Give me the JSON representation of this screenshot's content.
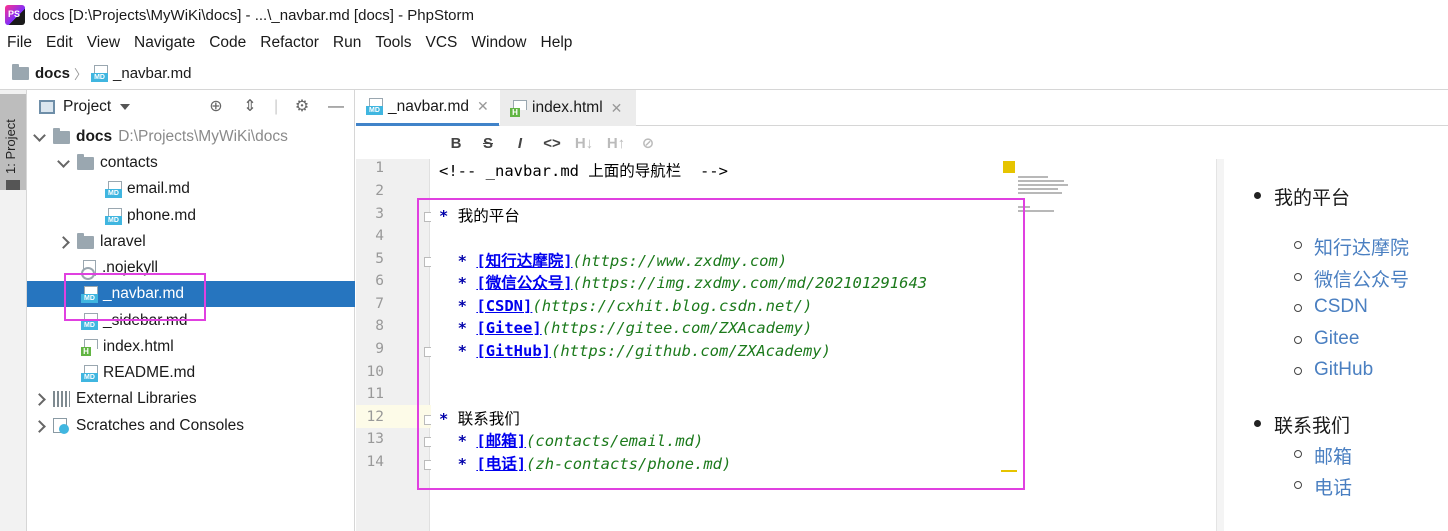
{
  "window": {
    "title": "docs [D:\\Projects\\MyWiKi\\docs] - ...\\_navbar.md [docs] - PhpStorm"
  },
  "menu": [
    "File",
    "Edit",
    "View",
    "Navigate",
    "Code",
    "Refactor",
    "Run",
    "Tools",
    "VCS",
    "Window",
    "Help"
  ],
  "breadcrumb": {
    "root": "docs",
    "file": "_navbar.md"
  },
  "side_strip": {
    "label": "1: Project"
  },
  "project_panel": {
    "title": "Project",
    "tree": [
      {
        "label": "docs",
        "path": "D:\\Projects\\MyWiKi\\docs"
      },
      {
        "label": "contacts"
      },
      {
        "label": "email.md"
      },
      {
        "label": "phone.md"
      },
      {
        "label": "laravel"
      },
      {
        "label": ".nojekyll"
      },
      {
        "label": "_navbar.md"
      },
      {
        "label": "_sidebar.md"
      },
      {
        "label": "index.html"
      },
      {
        "label": "README.md"
      },
      {
        "label": "External Libraries"
      },
      {
        "label": "Scratches and Consoles"
      }
    ]
  },
  "editor_tabs": [
    {
      "label": "_navbar.md",
      "active": true
    },
    {
      "label": "index.html",
      "active": false
    }
  ],
  "md_toolbar": [
    "B",
    "S",
    "I",
    "<>",
    "H↓",
    "H↑",
    "link"
  ],
  "code_lines": {
    "l1": "<!-- _navbar.md 上面的导航栏  -->",
    "l3": "我的平台",
    "l5_link": "[知行达摩院]",
    "l5_url": "(https://www.zxdmy.com)",
    "l6_link": "[微信公众号]",
    "l6_url": "(https://img.zxdmy.com/md/202101291643",
    "l7_link": "[CSDN]",
    "l7_url": "(https://cxhit.blog.csdn.net/)",
    "l8_link": "[Gitee]",
    "l8_url": "(https://gitee.com/ZXAcademy)",
    "l9_link": "[GitHub]",
    "l9_url": "(https://github.com/ZXAcademy)",
    "l12": "联系我们",
    "l13_link": "[邮箱]",
    "l13_url": "(contacts/email.md)",
    "l14_link": "[电话]",
    "l14_url": "(zh-contacts/phone.md)",
    "bullet": "*"
  },
  "line_numbers": [
    "1",
    "2",
    "3",
    "4",
    "5",
    "6",
    "7",
    "8",
    "9",
    "10",
    "11",
    "12",
    "13",
    "14"
  ],
  "preview": {
    "section1": "我的平台",
    "links1": [
      "知行达摩院",
      "微信公众号",
      "CSDN",
      "Gitee",
      "GitHub"
    ],
    "section2": "联系我们",
    "links2": [
      "邮箱",
      "电话"
    ]
  },
  "colors": {
    "selection": "#2675bf",
    "highlight_box": "#e040e0",
    "link": "#0000ee",
    "url": "#1c7a1c",
    "preview_link": "#4a7fc1"
  }
}
